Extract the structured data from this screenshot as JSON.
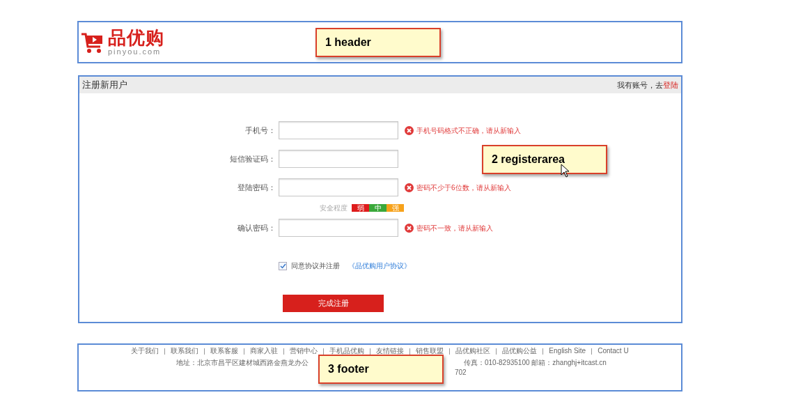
{
  "header": {
    "logo_text": "品优购",
    "logo_domain": "pinyou.com",
    "annotation": "1 header"
  },
  "register": {
    "title": "注册新用户",
    "login_prompt": "我有账号，去",
    "login_link": "登陆",
    "annotation": "2 registerarea",
    "fields": [
      {
        "label": "手机号：",
        "error": "手机号码格式不正确，请从新输入"
      },
      {
        "label": "短信验证码："
      },
      {
        "label": "登陆密码：",
        "error": "密码不少于6位数，请从新输入"
      },
      {
        "label": "确认密码：",
        "error": "密码不一致，请从新输入"
      }
    ],
    "strength": {
      "label": "安全程度",
      "levels": [
        {
          "label": "弱",
          "color": "#de1c1c"
        },
        {
          "label": "中",
          "color": "#3aa83a"
        },
        {
          "label": "强",
          "color": "#f7a21b"
        }
      ]
    },
    "agree": {
      "checked": true,
      "label": "同意协议并注册",
      "link": "《品优购用户协议》"
    },
    "submit": "完成注册"
  },
  "footer": {
    "links": [
      "关于我们",
      "联系我们",
      "联系客服",
      "商家入驻",
      "营销中心",
      "手机品优购",
      "友情链接",
      "销售联盟",
      "品优购社区",
      "品优购公益",
      "English Site",
      "Contact U"
    ],
    "address": "地址：北京市昌平区建材城西路金燕龙办公",
    "contact": "传真：010-82935100 邮箱：zhanghj+itcast.cn",
    "line_3": "702",
    "annotation": "3 footer"
  }
}
